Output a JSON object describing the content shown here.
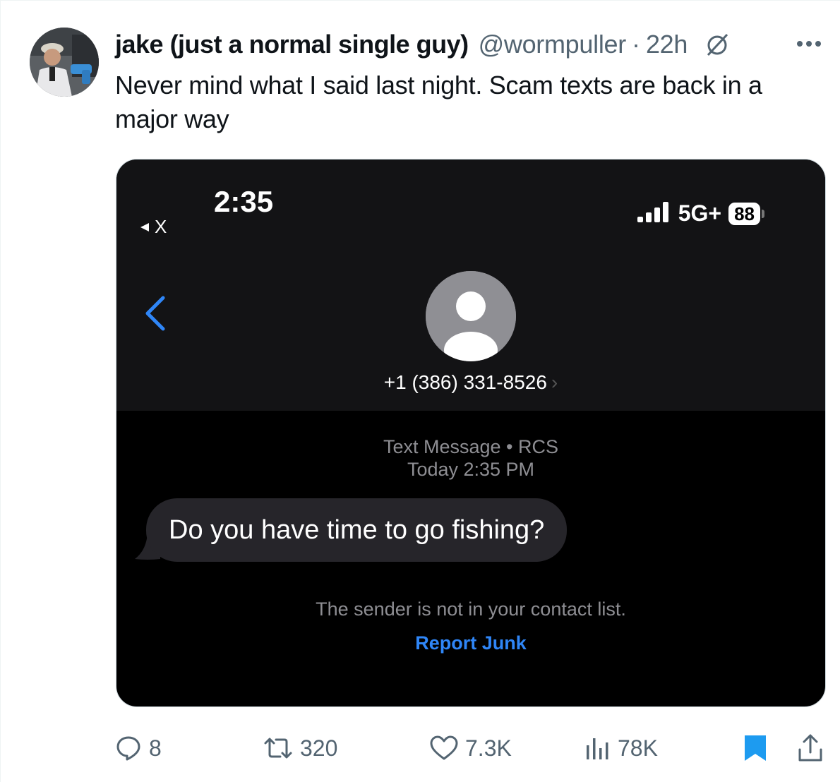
{
  "tweet": {
    "display_name": "jake (just a normal single guy)",
    "handle": "@wormpuller",
    "separator": "·",
    "time": "22h",
    "text": "Never mind what I said last night. Scam texts are back in a major way"
  },
  "screenshot": {
    "status_time": "2:35",
    "back_app": "X",
    "network": "5G+",
    "battery": "88",
    "contact_number": "+1 (386) 331-8526",
    "message_type": "Text Message • RCS",
    "message_time": "Today 2:35 PM",
    "message_text": "Do you have time to go fishing?",
    "notice": "The sender is not in your contact list.",
    "report_label": "Report Junk"
  },
  "actions": {
    "replies": "8",
    "reposts": "320",
    "likes": "7.3K",
    "views": "78K"
  },
  "colors": {
    "accent_blue": "#1d9bf0",
    "text_primary": "#0f1419",
    "text_secondary": "#536471",
    "ios_link": "#2f86f7"
  },
  "icons": [
    "grok-icon",
    "more-icon",
    "reply-icon",
    "repost-icon",
    "like-icon",
    "views-icon",
    "bookmark-icon",
    "share-icon"
  ]
}
